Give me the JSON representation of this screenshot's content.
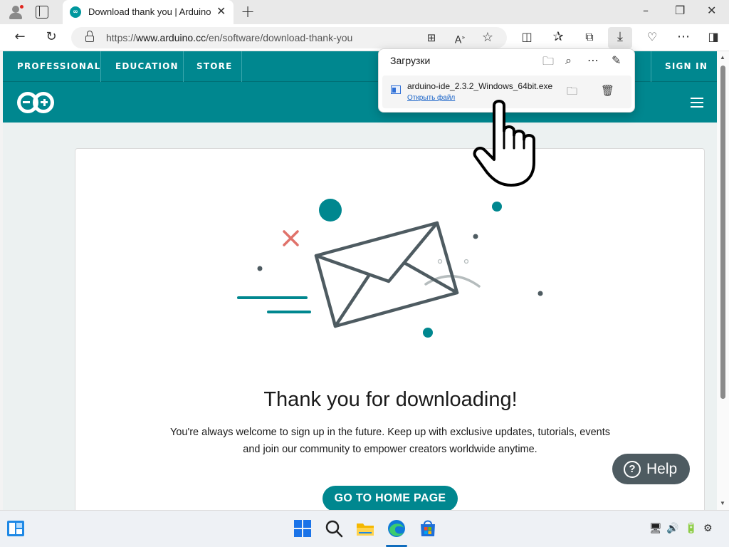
{
  "browser": {
    "tab_title": "Download thank you | Arduino",
    "tab_favicon": "∞",
    "url_prefix": "https://",
    "url_host": "www.arduino.cc",
    "url_path": "/en/software/download-thank-you"
  },
  "nav": {
    "top_links": [
      "PROFESSIONAL",
      "EDUCATION",
      "STORE"
    ],
    "sign_in": "SIGN IN"
  },
  "content": {
    "title": "Thank you for downloading!",
    "text": "You're always welcome to sign up in the future. Keep up with exclusive updates, tutorials, events and join our community to empower creators worldwide anytime.",
    "home_button": "GO TO HOME PAGE",
    "help_button": "Help",
    "help_icon": "?"
  },
  "downloads": {
    "title": "Загрузки",
    "file_name": "arduino-ide_2.3.2_Windows_64bit.exe",
    "open_file": "Открыть файл"
  },
  "colors": {
    "accent": "#00878f",
    "help": "#4e5b61",
    "cross": "#e0726a"
  }
}
